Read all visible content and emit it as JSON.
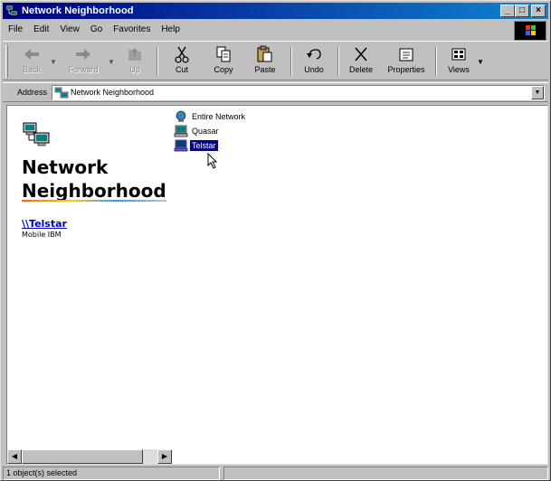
{
  "window": {
    "title": "Network Neighborhood",
    "controls": {
      "minimize": "_",
      "maximize": "□",
      "close": "×"
    }
  },
  "menu": {
    "items": [
      "File",
      "Edit",
      "View",
      "Go",
      "Favorites",
      "Help"
    ]
  },
  "toolbar": {
    "back": "Back",
    "forward": "Forward",
    "up": "Up",
    "cut": "Cut",
    "copy": "Copy",
    "paste": "Paste",
    "undo": "Undo",
    "delete": "Delete",
    "properties": "Properties",
    "views": "Views"
  },
  "address": {
    "label": "Address",
    "value": "Network Neighborhood"
  },
  "webview": {
    "title_line1": "Network",
    "title_line2": "Neighborhood",
    "selected_name": "\\\\Telstar",
    "selected_comment": "Mobile IBM"
  },
  "files": [
    {
      "label": "Entire Network",
      "icon": "entire-network-icon",
      "selected": false
    },
    {
      "label": "Quasar",
      "icon": "computer-icon",
      "selected": false
    },
    {
      "label": "Telstar",
      "icon": "computer-icon",
      "selected": true
    }
  ],
  "status": {
    "text": "1 object(s) selected"
  },
  "colors": {
    "titlebar_start": "#000080",
    "titlebar_end": "#1084d0",
    "selection": "#000080",
    "link": "#0000cc"
  }
}
